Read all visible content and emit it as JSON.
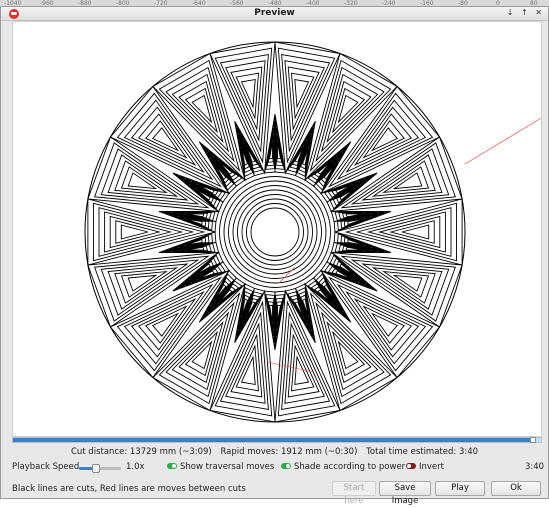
{
  "ruler": {
    "ticks": [
      "-1040",
      "-960",
      "-880",
      "-800",
      "-720",
      "-640",
      "-560",
      "-480",
      "-400",
      "-320",
      "-240",
      "-160",
      "-80",
      "0",
      "80"
    ]
  },
  "window": {
    "title": "Preview",
    "controls": [
      "↓",
      "↑",
      "✕"
    ]
  },
  "stats": {
    "cut_distance": "Cut distance: 13729 mm (~3:09)",
    "rapid_moves": "Rapid moves: 1912 mm (~0:30)",
    "total_time": "Total time estimated: 3:40"
  },
  "playback": {
    "label": "Playback Speed",
    "speed": "1.0x",
    "slider_fraction": 0.4,
    "progress_fraction": 0.985,
    "time": "3:40"
  },
  "options": [
    {
      "label": "Show traversal moves",
      "on": true
    },
    {
      "label": "Shade according to power",
      "on": true
    },
    {
      "label": "Invert",
      "on": false
    }
  ],
  "footer": {
    "hint": "Black lines are cuts, Red lines are moves between cuts"
  },
  "buttons": {
    "start_here": "Start here",
    "save_image": "Save Image",
    "play": "Play",
    "ok": "Ok"
  },
  "colors": {
    "cut": "#000000",
    "traversal": "#e0413b",
    "accent": "#3b82c4"
  }
}
